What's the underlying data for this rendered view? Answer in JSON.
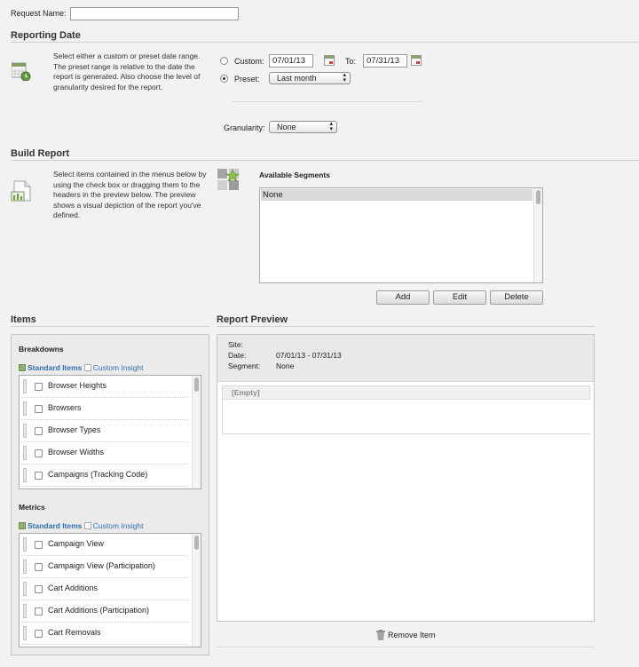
{
  "request": {
    "label": "Request Name:",
    "value": ""
  },
  "reporting_date": {
    "title": "Reporting Date",
    "description": "Select either a custom or preset date range. The preset range is relative to the date the report is generated. Also choose the level of granularity desired for the report.",
    "custom_label": "Custom:",
    "custom_from": "07/01/13",
    "to_label": "To:",
    "custom_to": "07/31/13",
    "preset_label": "Preset:",
    "preset_value": "Last month",
    "granularity_label": "Granularity:",
    "granularity_value": "None",
    "selected": "preset"
  },
  "build_report": {
    "title": "Build Report",
    "description": "Select items contained in the menus below by using the check box or dragging them to the headers in the preview below. The preview shows a visual depiction of the report you've defined.",
    "segments_title": "Available Segments",
    "segments": [
      "None"
    ],
    "buttons": {
      "add": "Add",
      "edit": "Edit",
      "delete": "Delete"
    }
  },
  "items": {
    "title": "Items",
    "breakdowns": {
      "title": "Breakdowns",
      "tab_standard": "Standard Items",
      "tab_custom": "Custom Insight",
      "list": [
        "Browser Heights",
        "Browsers",
        "Browser Types",
        "Browser Widths",
        "Campaigns (Tracking Code)"
      ]
    },
    "metrics": {
      "title": "Metrics",
      "tab_standard": "Standard Items",
      "tab_custom": "Custom Insight",
      "list": [
        "Campaign View",
        "Campaign View (Participation)",
        "Cart Additions",
        "Cart Additions (Participation)",
        "Cart Removals"
      ]
    }
  },
  "preview": {
    "title": "Report Preview",
    "site_label": "Site:",
    "site_value": "",
    "date_label": "Date:",
    "date_value": "07/01/13 - 07/31/13",
    "segment_label": "Segment:",
    "segment_value": "None",
    "empty_label": "[Empty]",
    "remove_label": "Remove Item"
  },
  "icons": [
    "calendar-icon",
    "report-builder-icon",
    "segments-icon",
    "trash-icon"
  ]
}
